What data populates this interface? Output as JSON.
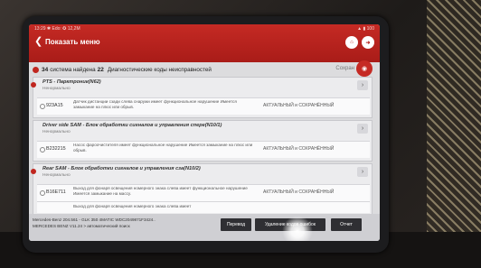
{
  "statusbar": {
    "left": "13:29 ✱ Edo: ✪ 12,2М",
    "right": "▲ ▮ 100"
  },
  "header": {
    "title": "Показать меню",
    "home_icon": "home-icon",
    "exit_icon": "exit-icon"
  },
  "summary": {
    "count": "34",
    "text_before": "система найдена",
    "dtc_count": "22",
    "text_after": "Диагностические коды неисправностей",
    "save_label": "Сохран"
  },
  "groups": [
    {
      "title": "PTS - Парктроник(N62)",
      "subtitle": "Ненормально",
      "rows": [
        {
          "code": "923A15",
          "desc": "Датчик дистанции сзади слева снаружи имеет функциональное нарушение Имеется замыкание на плюс или обрыв.",
          "status": "АКТУАЛЬНЫЙ и СОХРАНЁННЫЙ"
        }
      ]
    },
    {
      "title": "Driver side SAM - Блок обработки сигналов и управления спере(N10/1)",
      "subtitle": "Ненормально",
      "rows": [
        {
          "code": "B232215",
          "desc": "Насос фароочистителя имеет функциональное нарушение Имеется замыкание на плюс или обрыв.",
          "status": "АКТУАЛЬНЫЙ и СОХРАНЁННЫЙ"
        }
      ]
    },
    {
      "title": "Rear SAM - Блок обработки сигналов и управления сза(N10/2)",
      "subtitle": "Ненормально",
      "rows": [
        {
          "code": "B16E711",
          "desc": "Выход для фонаря освещения номерного знака слева имеет функциональное нарушение Имеется замыкание на массу.",
          "status": "АКТУАЛЬНЫЙ и СОХРАНЁННЫЙ"
        },
        {
          "code": "",
          "desc": "Выход для фонаря освещения номерного знака слева имеет",
          "status": ""
        }
      ]
    }
  ],
  "footer": {
    "vin_line1": "Mercedes-Benz 204.561 - GLK 350 4MATIC WDC2049871F3424..",
    "vin_line2": "MERCEDES BENZ V11.24 > автоматический поиск",
    "translate": "Перевод",
    "clear": "Удаление кодов ошибок",
    "report": "Отчет"
  }
}
